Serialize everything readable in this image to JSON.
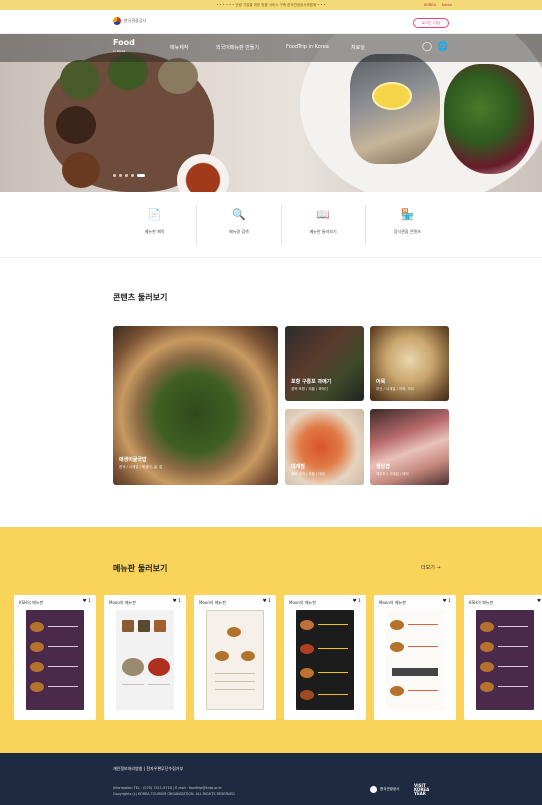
{
  "top_notice": "• • • • • • 관광 기업을 위한 맞춤 서비스 구축 한국관광공사와함께 • • •",
  "top_extra": [
    "KOREA",
    "Korea"
  ],
  "brand": {
    "name": "한국관광공사",
    "login": "로그인 /가입"
  },
  "nav": {
    "logo_main": "Food",
    "logo_sub": "in Korea",
    "menu": [
      "메뉴제작",
      "외국어메뉴판 만들기",
      "FoodTrip in Korea",
      "자료실"
    ],
    "icons": [
      "user-icon",
      "globe-icon"
    ]
  },
  "quick_links": [
    {
      "icon": "menu-doc-icon",
      "label": "메뉴판 제작"
    },
    {
      "icon": "menu-search-icon",
      "label": "메뉴명 검색"
    },
    {
      "icon": "menu-book-icon",
      "label": "메뉴판 둘러보기"
    },
    {
      "icon": "store-icon",
      "label": "음식관광 콘텐츠"
    }
  ],
  "contents": {
    "title": "콘텐츠 둘러보기",
    "cards": [
      {
        "title": "매생이굴국밥",
        "sub": "한국 / 사계절 / 매생이, 굴, 밥"
      },
      {
        "title": "포항 구룡포 과메기",
        "sub": "경북 포항 / 겨울 / 과메기"
      },
      {
        "title": "어묵",
        "sub": "부산 / 사계절 / 어묵, 꼬치"
      },
      {
        "title": "대게찜",
        "sub": "경북 영덕 / 겨울 / 대게"
      },
      {
        "title": "생삼겹",
        "sub": "제주도 / 사계절 / 돼지"
      }
    ]
  },
  "menus": {
    "title": "메뉴판 둘러보기",
    "more": "더보기 →",
    "cards": [
      {
        "owner": "KSH의 메뉴판",
        "likes": "1"
      },
      {
        "owner": "Moon의 메뉴판",
        "likes": "1"
      },
      {
        "owner": "Moon의 메뉴판",
        "likes": "1"
      },
      {
        "owner": "Moon의 메뉴판",
        "likes": "1"
      },
      {
        "owner": "Moon의 메뉴판",
        "likes": "1"
      },
      {
        "owner": "KSH의 메뉴판",
        "likes": "1"
      }
    ]
  },
  "footer": {
    "links": "개인정보처리방침  |  전자우편무단수집거부",
    "info1": "Information TEL : (070) 7511-9718  |  E-mail : foodtrip@knto.or.kr",
    "info2": "Copyrights (c) KOREA TOURISM ORGANIZATION. ALL RIGHTS RESERVED",
    "org": "한국관광공사",
    "campaign1": "VISIT",
    "campaign2": "KOREA",
    "campaign3": "YEAR"
  },
  "colors": {
    "accent": "#f9d35a",
    "footer": "#1e2a3f",
    "login": "#e47"
  }
}
